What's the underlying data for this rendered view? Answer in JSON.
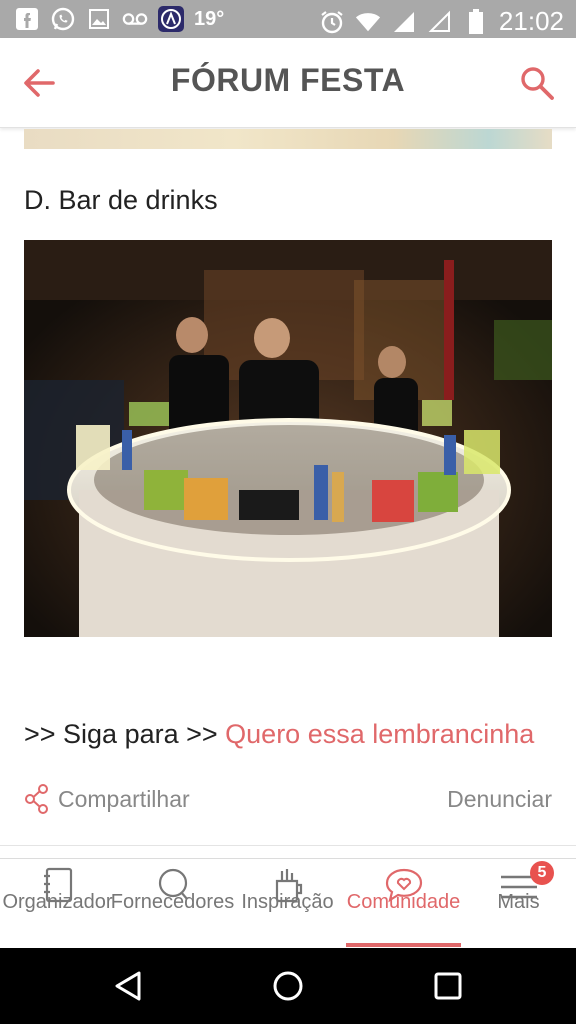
{
  "status_bar": {
    "temperature": "19°",
    "time": "21:02",
    "icons": [
      "facebook-icon",
      "whatsapp-icon",
      "image-icon",
      "voicemail-icon",
      "app-icon",
      "alarm-icon",
      "wifi-icon",
      "signal-icon",
      "signal-empty-icon",
      "battery-icon"
    ]
  },
  "app_bar": {
    "title": "FÓRUM FESTA",
    "back_icon": "back-arrow-icon",
    "search_icon": "search-icon"
  },
  "post": {
    "section_heading": "D. Bar de drinks",
    "photo_description_icon": "bar-photo",
    "next_prefix": ">> Siga para >> ",
    "next_link": "Quero essa lembrancinha",
    "share_label": "Compartilhar",
    "report_label": "Denunciar"
  },
  "tabs": [
    {
      "label": "Organizador",
      "icon": "notebook-icon",
      "active": false
    },
    {
      "label": "Fornecedores",
      "icon": "search-circle-icon",
      "active": false
    },
    {
      "label": "Inspiração",
      "icon": "brushes-icon",
      "active": false
    },
    {
      "label": "Comunidade",
      "icon": "heart-bubble-icon",
      "active": true
    },
    {
      "label": "Mais",
      "icon": "menu-icon",
      "active": false,
      "badge": "5"
    }
  ],
  "colors": {
    "accent": "#e0686a",
    "status_bar": "#a9a9a9",
    "badge": "#e8524f"
  }
}
